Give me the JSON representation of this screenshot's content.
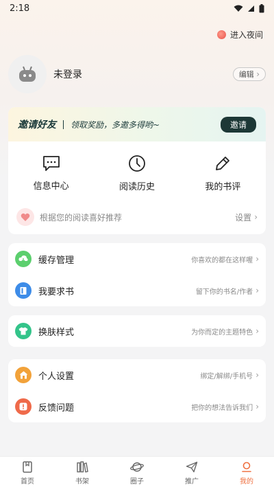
{
  "status_bar": {
    "time": "2:18"
  },
  "night_mode": {
    "label": "进入夜间"
  },
  "profile": {
    "name": "未登录",
    "edit_label": "编辑"
  },
  "invite": {
    "title": "邀请好友",
    "subtitle": "领取奖励，多邀多得哟~",
    "button": "邀请"
  },
  "quick_actions": [
    {
      "label": "信息中心",
      "icon": "message-icon"
    },
    {
      "label": "阅读历史",
      "icon": "clock-icon"
    },
    {
      "label": "我的书评",
      "icon": "pencil-icon"
    }
  ],
  "recommend": {
    "text": "根据您的阅读喜好推荐",
    "action": "设置"
  },
  "group1": [
    {
      "label": "缓存管理",
      "hint": "你喜欢的都在这样喔",
      "icon": "cloud-download-icon",
      "color": "#5ccf6e"
    },
    {
      "label": "我要求书",
      "hint": "留下你的书名/作者",
      "icon": "book-icon",
      "color": "#3d8ce8"
    }
  ],
  "group2": [
    {
      "label": "换肤样式",
      "hint": "为你而定的主题特色",
      "icon": "shirt-icon",
      "color": "#34c48a"
    }
  ],
  "group3": [
    {
      "label": "个人设置",
      "hint": "绑定/解绑/手机号",
      "icon": "home-icon",
      "color": "#f2a23a"
    },
    {
      "label": "反馈问题",
      "hint": "把你的想法告诉我们",
      "icon": "feedback-icon",
      "color": "#ef6a4a"
    }
  ],
  "bottom_nav": [
    {
      "label": "首页",
      "icon": "book-home-icon",
      "active": false
    },
    {
      "label": "书架",
      "icon": "bookshelf-icon",
      "active": false
    },
    {
      "label": "圈子",
      "icon": "planet-icon",
      "active": false
    },
    {
      "label": "推广",
      "icon": "paper-plane-icon",
      "active": false
    },
    {
      "label": "我的",
      "icon": "user-icon",
      "active": true
    }
  ],
  "colors": {
    "accent": "#ef7040",
    "invite_button": "#1d3836"
  }
}
